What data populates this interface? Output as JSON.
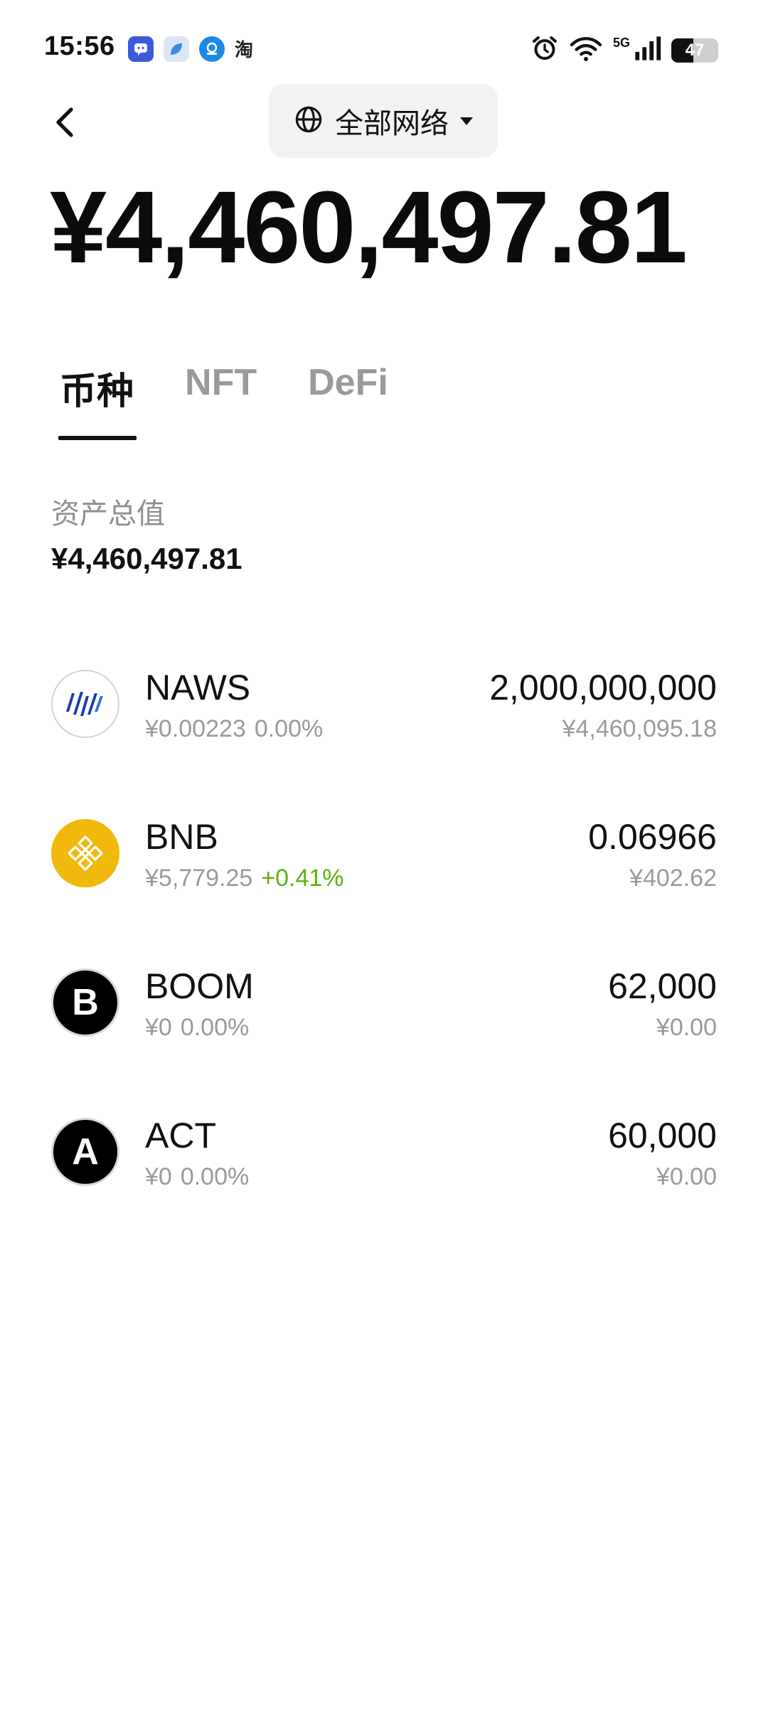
{
  "status_bar": {
    "time": "15:56",
    "notif_taobao": "淘",
    "network_5g": "5G",
    "battery": "47",
    "battery_level": 0.47,
    "icons": [
      "app-notification-icon",
      "alarm-icon",
      "wifi-icon",
      "signal-icon",
      "battery-icon"
    ]
  },
  "header": {
    "network_selector": "全部网络"
  },
  "total_balance": "¥4,460,497.81",
  "tabs": [
    {
      "label": "币种",
      "active": true
    },
    {
      "label": "NFT",
      "active": false
    },
    {
      "label": "DeFi",
      "active": false
    }
  ],
  "asset_summary": {
    "label": "资产总值",
    "value": "¥4,460,497.81"
  },
  "tokens": [
    {
      "symbol": "NAWS",
      "price": "¥0.00223",
      "change": "0.00%",
      "amount": "2,000,000,000",
      "value": "¥4,460,095.18",
      "icon": "naws-logo-icon"
    },
    {
      "symbol": "BNB",
      "price": "¥5,779.25",
      "change": "+0.41%",
      "amount": "0.06966",
      "value": "¥402.62",
      "icon": "bnb-logo-icon"
    },
    {
      "symbol": "BOOM",
      "price": "¥0",
      "change": "0.00%",
      "amount": "62,000",
      "value": "¥0.00",
      "icon_letter": "B"
    },
    {
      "symbol": "ACT",
      "price": "¥0",
      "change": "0.00%",
      "amount": "60,000",
      "value": "¥0.00",
      "icon_letter": "A"
    }
  ],
  "colors": {
    "positive_change": "#5ab30e",
    "muted_text": "#9a9a9a",
    "bnb_yellow": "#f0b90b"
  }
}
